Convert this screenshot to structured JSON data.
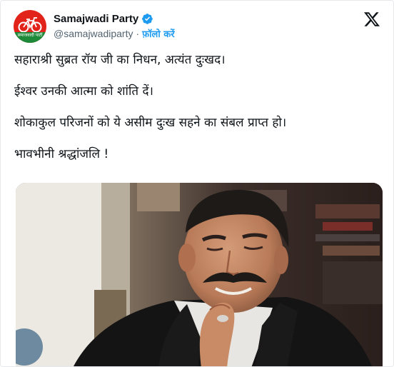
{
  "account": {
    "name": "Samajwadi Party",
    "handle": "@samajwadiparty",
    "separator": "·",
    "follow_label": "फ़ॉलो करें",
    "logo_text": "समाजवादी पार्टी",
    "verified": true
  },
  "icons": {
    "avatar": "samajwadi-party-logo",
    "verified": "verified-badge-icon",
    "platform": "x-logo-icon"
  },
  "tweet": {
    "lines": [
      "सहाराश्री सुब्रत रॉय जी का निधन, अत्यंत दुःखद।",
      "ईश्वर उनकी आत्मा को शांति दें।",
      "शोकाकुल परिजनों को ये असीम दुःख सहने का संबल प्राप्त हो।",
      "भावभीनी श्रद्धांजलि !"
    ]
  },
  "media": {
    "kind": "photo"
  },
  "colors": {
    "accent": "#1d9bf0",
    "text": "#0f1419",
    "muted": "#536471",
    "logo_red": "#e2231a",
    "logo_green": "#1d8a3a"
  }
}
